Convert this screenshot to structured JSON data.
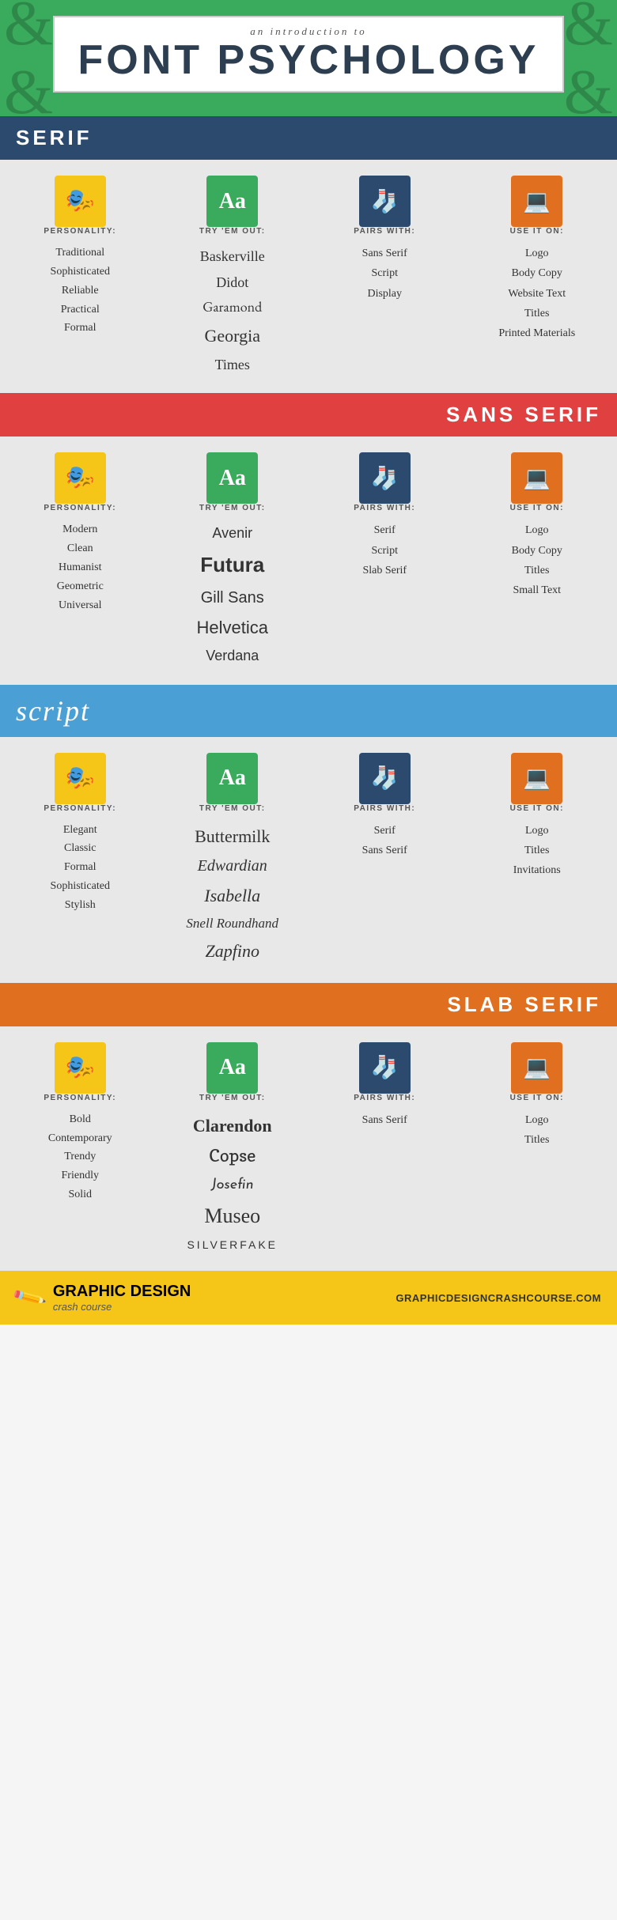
{
  "header": {
    "subtitle": "an introduction to",
    "title_italic": "an introduction to",
    "title_main": "FONT PSYCHOLOGY",
    "deco_char": "&"
  },
  "sections": [
    {
      "id": "serif",
      "label": "SERIF",
      "label_type": "serif-label",
      "label_align": "left",
      "personality_header": "PERSONALITY:",
      "tryout_header": "TRY 'EM OUT:",
      "pairs_header": "PAIRS WITH:",
      "useit_header": "USE IT ON:",
      "personality": [
        "Traditional",
        "Sophisticated",
        "Reliable",
        "Practical",
        "Formal"
      ],
      "tryout": [
        {
          "text": "Baskerville",
          "class": "font-baskerville"
        },
        {
          "text": "Didot",
          "class": "font-didot"
        },
        {
          "text": "Garamond",
          "class": "font-garamond"
        },
        {
          "text": "Georgia",
          "class": "font-georgia"
        },
        {
          "text": "Times",
          "class": "font-times"
        }
      ],
      "pairs": [
        "Sans Serif",
        "Script",
        "Display"
      ],
      "useit": [
        "Logo",
        "Body Copy",
        "Website Text",
        "Titles",
        "Printed Materials"
      ]
    },
    {
      "id": "sans-serif",
      "label": "SANS SERIF",
      "label_type": "sansserif-label",
      "label_align": "right",
      "personality_header": "PERSONALITY:",
      "tryout_header": "TRY 'EM OUT:",
      "pairs_header": "PAIRS WITH:",
      "useit_header": "USE IT ON:",
      "personality": [
        "Modern",
        "Clean",
        "Humanist",
        "Geometric",
        "Universal"
      ],
      "tryout": [
        {
          "text": "Avenir",
          "class": "font-avenir"
        },
        {
          "text": "Futura",
          "class": "font-futura"
        },
        {
          "text": "Gill Sans",
          "class": "font-gillsans"
        },
        {
          "text": "Helvetica",
          "class": "font-helvetica"
        },
        {
          "text": "Verdana",
          "class": "font-verdana"
        }
      ],
      "pairs": [
        "Serif",
        "Script",
        "Slab Serif"
      ],
      "useit": [
        "Logo",
        "Body Copy",
        "Titles",
        "Small Text"
      ]
    },
    {
      "id": "script",
      "label": "script",
      "label_type": "script-label",
      "label_align": "left",
      "personality_header": "PERSONALITY:",
      "tryout_header": "TRY 'EM OUT:",
      "pairs_header": "PAIRS WITH:",
      "useit_header": "USE IT ON:",
      "personality": [
        "Elegant",
        "Classic",
        "Formal",
        "Sophisticated",
        "Stylish"
      ],
      "tryout": [
        {
          "text": "Buttermilk",
          "class": "font-buttermilk"
        },
        {
          "text": "Edwardian",
          "class": "font-edwardian"
        },
        {
          "text": "Isabella",
          "class": "font-isabella"
        },
        {
          "text": "Snell Roundhand",
          "class": "font-snell"
        },
        {
          "text": "Zapfino",
          "class": "font-zapfino"
        }
      ],
      "pairs": [
        "Serif",
        "Sans Serif"
      ],
      "useit": [
        "Logo",
        "Titles",
        "Invitations"
      ]
    },
    {
      "id": "slab-serif",
      "label": "SLAB SERIF",
      "label_type": "slabserif-label",
      "label_align": "right",
      "personality_header": "PERSONALITY:",
      "tryout_header": "TRY 'EM OUT:",
      "pairs_header": "PAIRS WITH:",
      "useit_header": "USE IT ON:",
      "personality": [
        "Bold",
        "Contemporary",
        "Trendy",
        "Friendly",
        "Solid"
      ],
      "tryout": [
        {
          "text": "Clarendon",
          "class": "font-clarendon"
        },
        {
          "text": "Copse",
          "class": "font-copse"
        },
        {
          "text": "Josefin",
          "class": "font-josefin"
        },
        {
          "text": "Museo",
          "class": "font-museo"
        },
        {
          "text": "SILVERFAKE",
          "class": "font-silverfake"
        }
      ],
      "pairs": [
        "Sans Serif"
      ],
      "useit": [
        "Logo",
        "Titles"
      ]
    }
  ],
  "footer": {
    "brand_bold": "GRAPHIC DESIGN",
    "brand_italic": "crash course",
    "url": "GRAPHICDESIGNCRASHCOURSE.COM"
  }
}
